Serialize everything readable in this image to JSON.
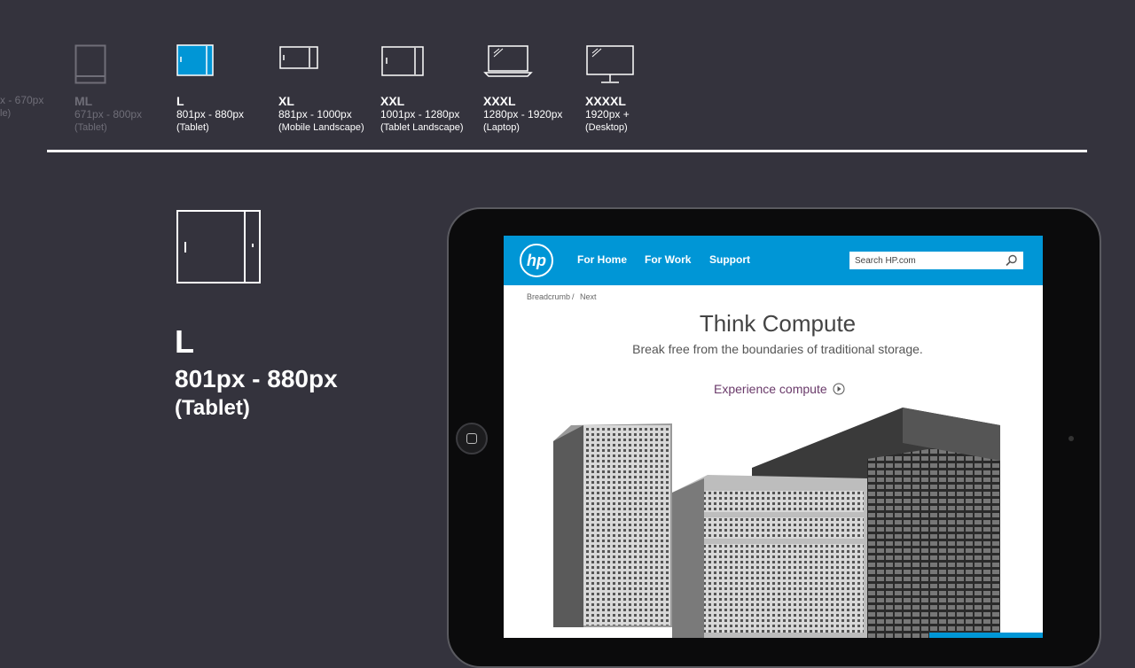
{
  "breakpoints": [
    {
      "name": "",
      "range": "x - 670px",
      "device": "le)",
      "active": false,
      "dim": true
    },
    {
      "name": "ML",
      "range": "671px - 800px",
      "device": "(Tablet)",
      "active": false,
      "dim": true
    },
    {
      "name": "L",
      "range": "801px - 880px",
      "device": "(Tablet)",
      "active": true,
      "dim": false
    },
    {
      "name": "XL",
      "range": "881px - 1000px",
      "device": "(Mobile Landscape)",
      "active": false,
      "dim": false
    },
    {
      "name": "XXL",
      "range": "1001px - 1280px",
      "device": "(Tablet Landscape)",
      "active": false,
      "dim": false
    },
    {
      "name": "XXXL",
      "range": "1280px - 1920px",
      "device": "(Laptop)",
      "active": false,
      "dim": false
    },
    {
      "name": "XXXXL",
      "range": "1920px +",
      "device": "(Desktop)",
      "active": false,
      "dim": false
    }
  ],
  "selected": {
    "name": "L",
    "range": "801px - 880px",
    "device": "(Tablet)"
  },
  "site": {
    "logo": "hp",
    "nav": [
      "For Home",
      "For Work",
      "Support"
    ],
    "search_placeholder": "Search HP.com",
    "breadcrumb": [
      "Breadcrumb",
      "Next"
    ],
    "breadcrumb_sep": "/",
    "hero_title": "Think Compute",
    "hero_subtitle": "Break free from the boundaries of traditional storage.",
    "cta": "Experience compute",
    "icons": {
      "search": "search-icon",
      "cta": "play-circle-icon"
    }
  },
  "colors": {
    "background": "#34333d",
    "accent": "#0096d6",
    "dim_text": "#6f6e78",
    "cta": "#6a3a6a"
  }
}
